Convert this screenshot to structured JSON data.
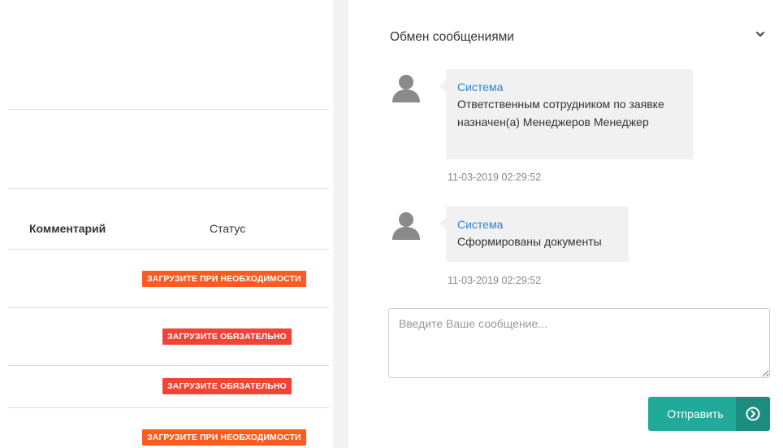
{
  "table": {
    "headers": {
      "comment": "Комментарий",
      "status": "Статус"
    },
    "rows": [
      {
        "status": "ЗАГРУЗИТЕ ПРИ НЕОБХОДИМОСТИ",
        "status_color": "#ff5a1f"
      },
      {
        "status": "ЗАГРУЗИТЕ ОБЯЗАТЕЛЬНО",
        "status_color": "#f44336"
      },
      {
        "status": "ЗАГРУЗИТЕ ОБЯЗАТЕЛЬНО",
        "status_color": "#f44336"
      },
      {
        "status": "ЗАГРУЗИТЕ ПРИ НЕОБХОДИМОСТИ",
        "status_color": "#ff5a1f"
      }
    ]
  },
  "chat": {
    "title": "Обмен сообщениями",
    "toggle_icon": "chevron-down-icon",
    "messages": [
      {
        "sender": "Система",
        "text": "Ответственным сотрудником по заявке назначен(а) Менеджеров Менеджер",
        "time": "11-03-2019 02:29:52"
      },
      {
        "sender": "Система",
        "text": "Сформированы документы",
        "time": "11-03-2019 02:29:52"
      }
    ],
    "input": {
      "placeholder": "Введите Ваше сообщение...",
      "value": ""
    },
    "send_button": {
      "label": "Отправить",
      "icon": "arrow-right-circle-icon"
    }
  },
  "colors": {
    "accent": "#21a99a",
    "accent_dark": "#1b8c80",
    "link": "#2f80d1",
    "badge_orange": "#ff5a1f",
    "badge_red": "#f44336"
  }
}
